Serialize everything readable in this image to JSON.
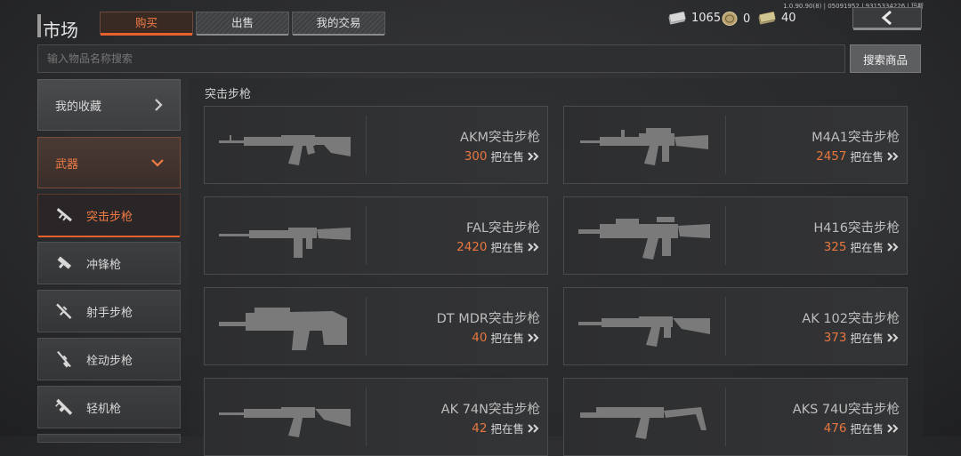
{
  "version": "1.0.90.90(8) | 05091952 | 9315334226 | 玛斯",
  "header": {
    "title": "市场",
    "tabs": [
      {
        "label": "购买",
        "active": true
      },
      {
        "label": "出售",
        "active": false
      },
      {
        "label": "我的交易",
        "active": false
      }
    ],
    "currencies": [
      {
        "icon": "cash-stack-icon",
        "value": "1065"
      },
      {
        "icon": "gold-coin-icon",
        "value": "0"
      },
      {
        "icon": "bond-stack-icon",
        "value": "40"
      }
    ]
  },
  "search": {
    "placeholder": "输入物品名称搜索",
    "value": "",
    "button": "搜索商品"
  },
  "sidebar": {
    "favorites": "我的收藏",
    "category": "武器",
    "items": [
      {
        "label": "突击步枪",
        "icon": "assault-rifle-icon",
        "active": true
      },
      {
        "label": "冲锋枪",
        "icon": "smg-icon",
        "active": false
      },
      {
        "label": "射手步枪",
        "icon": "marksman-rifle-icon",
        "active": false
      },
      {
        "label": "栓动步枪",
        "icon": "bolt-rifle-icon",
        "active": false
      },
      {
        "label": "轻机枪",
        "icon": "lmg-icon",
        "active": false
      }
    ]
  },
  "main": {
    "section_title": "突击步枪",
    "sale_label": "把在售",
    "items": [
      {
        "name": "AKM突击步枪",
        "count": "300",
        "icon": "akm-icon"
      },
      {
        "name": "M4A1突击步枪",
        "count": "2457",
        "icon": "m4a1-icon"
      },
      {
        "name": "FAL突击步枪",
        "count": "2420",
        "icon": "fal-icon"
      },
      {
        "name": "H416突击步枪",
        "count": "325",
        "icon": "h416-icon"
      },
      {
        "name": "DT MDR突击步枪",
        "count": "40",
        "icon": "mdr-icon"
      },
      {
        "name": "AK 102突击步枪",
        "count": "373",
        "icon": "ak102-icon"
      },
      {
        "name": "AK 74N突击步枪",
        "count": "42",
        "icon": "ak74n-icon"
      },
      {
        "name": "AKS 74U突击步枪",
        "count": "476",
        "icon": "aks74u-icon"
      }
    ]
  }
}
